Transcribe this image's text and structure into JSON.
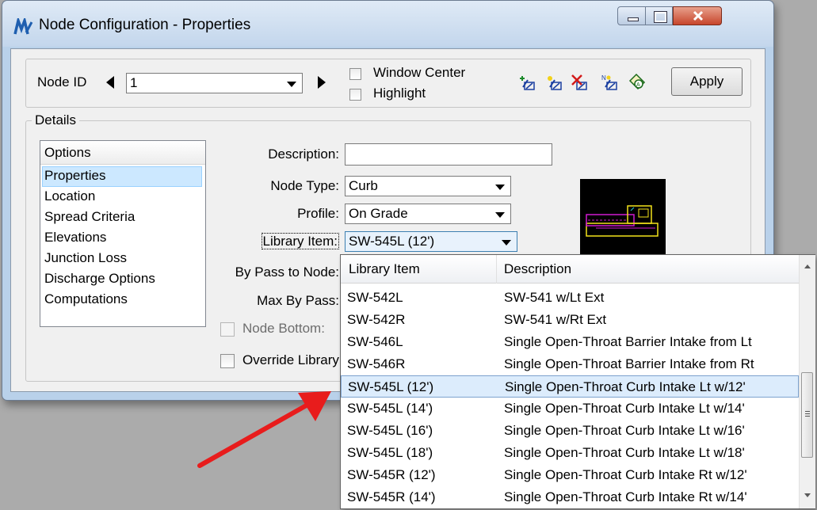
{
  "window": {
    "title": "Node Configuration - Properties",
    "icon": "app-logo-icon",
    "close_icon": "x"
  },
  "nodebar": {
    "node_id_label": "Node ID",
    "node_id_value": "1",
    "window_center_label": "Window Center",
    "highlight_label": "Highlight",
    "apply_label": "Apply"
  },
  "details": {
    "legend": "Details",
    "options_header": "Options",
    "options": [
      "Properties",
      "Location",
      "Spread Criteria",
      "Elevations",
      "Junction Loss",
      "Discharge Options",
      "Computations"
    ],
    "description_label": "Description:",
    "description_value": "",
    "node_type_label": "Node Type:",
    "node_type_value": "Curb",
    "profile_label": "Profile:",
    "profile_value": "On Grade",
    "library_item_label": "Library Item:",
    "library_item_value": "SW-545L (12')",
    "bypass_label": "By Pass to Node:",
    "max_bypass_label": "Max By Pass:",
    "node_bottom_label": "Node Bottom:",
    "override_label": "Override Library"
  },
  "dropdown": {
    "header_item": "Library Item",
    "header_desc": "Description",
    "selected_index": 4,
    "rows": [
      {
        "item": "SW-542L",
        "desc": "SW-541 w/Lt Ext"
      },
      {
        "item": "SW-542R",
        "desc": "SW-541 w/Rt Ext"
      },
      {
        "item": "SW-546L",
        "desc": "Single Open-Throat Barrier Intake from Lt"
      },
      {
        "item": "SW-546R",
        "desc": "Single Open-Throat Barrier Intake from Rt"
      },
      {
        "item": "SW-545L (12')",
        "desc": "Single Open-Throat Curb Intake Lt w/12'"
      },
      {
        "item": "SW-545L (14')",
        "desc": "Single Open-Throat Curb Intake Lt w/14'"
      },
      {
        "item": "SW-545L (16')",
        "desc": "Single Open-Throat Curb Intake Lt w/16'"
      },
      {
        "item": "SW-545L (18')",
        "desc": "Single Open-Throat Curb Intake Lt w/18'"
      },
      {
        "item": "SW-545R (12')",
        "desc": "Single Open-Throat Curb Intake Rt w/12'"
      },
      {
        "item": "SW-545R (14')",
        "desc": "Single Open-Throat Curb Intake Rt w/14'"
      }
    ]
  },
  "colors": {
    "annotation_arrow": "#e81c1c",
    "selection": "#dcecfc"
  }
}
